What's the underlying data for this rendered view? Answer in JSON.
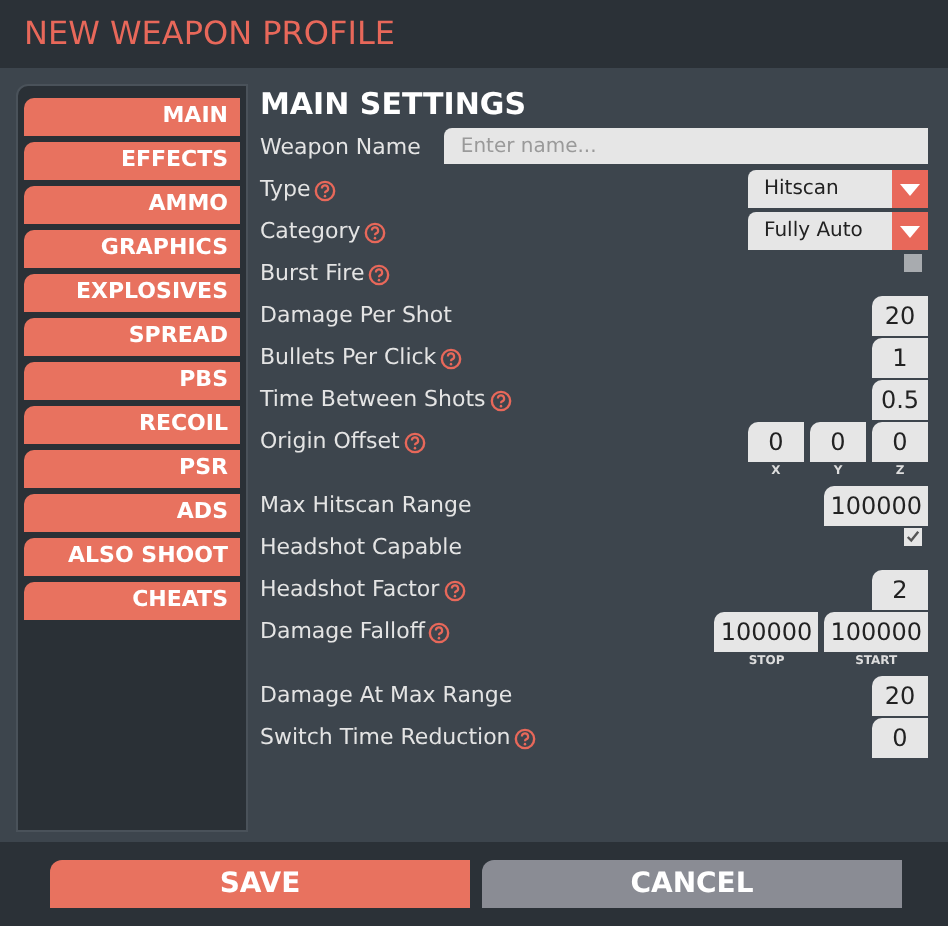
{
  "title": "NEW WEAPON PROFILE",
  "sidebar": [
    "MAIN",
    "EFFECTS",
    "AMMO",
    "GRAPHICS",
    "EXPLOSIVES",
    "SPREAD",
    "PBS",
    "RECOIL",
    "PSR",
    "ADS",
    "ALSO SHOOT",
    "CHEATS"
  ],
  "section_title": "MAIN SETTINGS",
  "settings": [
    {
      "kind": "text",
      "label": "Weapon Name",
      "help": false,
      "placeholder": "Enter name..."
    },
    {
      "kind": "dropdown",
      "label": "Type",
      "help": true,
      "value": "Hitscan"
    },
    {
      "kind": "dropdown",
      "label": "Category",
      "help": true,
      "value": "Fully Auto"
    },
    {
      "kind": "checkbox",
      "label": "Burst Fire",
      "help": true,
      "checked": false
    },
    {
      "kind": "number",
      "label": "Damage Per Shot",
      "help": false,
      "fields": [
        {
          "value": "20"
        }
      ]
    },
    {
      "kind": "number",
      "label": "Bullets Per Click",
      "help": true,
      "fields": [
        {
          "value": "1"
        }
      ]
    },
    {
      "kind": "number",
      "label": "Time Between Shots",
      "help": true,
      "fields": [
        {
          "value": "0.5"
        }
      ]
    },
    {
      "kind": "number",
      "label": "Origin Offset",
      "help": true,
      "fields": [
        {
          "value": "0",
          "caption": "X"
        },
        {
          "value": "0",
          "caption": "Y"
        },
        {
          "value": "0",
          "caption": "Z"
        }
      ]
    },
    {
      "kind": "number",
      "label": "Max Hitscan Range",
      "help": false,
      "fields": [
        {
          "value": "100000"
        }
      ]
    },
    {
      "kind": "checkbox",
      "label": "Headshot Capable",
      "help": false,
      "checked": true
    },
    {
      "kind": "number",
      "label": "Headshot Factor",
      "help": true,
      "fields": [
        {
          "value": "2"
        }
      ]
    },
    {
      "kind": "number",
      "label": "Damage Falloff",
      "help": true,
      "fields": [
        {
          "value": "100000",
          "caption": "STOP"
        },
        {
          "value": "100000",
          "caption": "START"
        }
      ]
    },
    {
      "kind": "number",
      "label": "Damage At Max Range",
      "help": false,
      "fields": [
        {
          "value": "20"
        }
      ]
    },
    {
      "kind": "number",
      "label": "Switch Time Reduction",
      "help": true,
      "fields": [
        {
          "value": "0"
        }
      ]
    }
  ],
  "buttons": [
    {
      "label": "SAVE",
      "kind": "primary"
    },
    {
      "label": "CANCEL",
      "kind": "secondary"
    }
  ]
}
